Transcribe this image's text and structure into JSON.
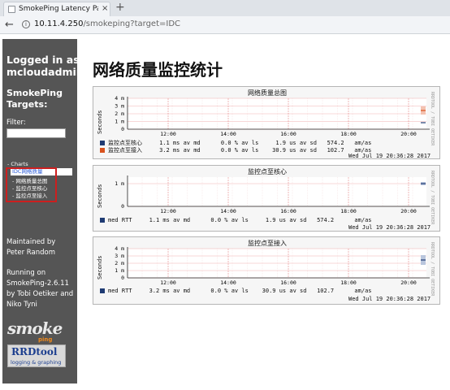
{
  "browser": {
    "tab_title": "SmokePing Latency Page for IDC",
    "tab_close": "×",
    "new_tab": "+",
    "back": "←",
    "forward": "→",
    "info": "i",
    "url_host": "10.11.4.250",
    "url_path": "/smokeping?target=IDC"
  },
  "sidebar": {
    "logged_in_line1": "Logged in as",
    "logged_in_line2": "mcloudadmin",
    "targets_line1": "SmokePing",
    "targets_line2": "Targets:",
    "filter_label": "Filter:",
    "charts_label": "- Charts",
    "current_target": "IDC网络质量",
    "items": [
      "- 网络质量总图",
      "- 监控点至核心",
      "- 监控点至接入"
    ],
    "maint_line1": "Maintained by",
    "maint_line2": "Peter Random",
    "running_lines": [
      "Running on",
      "SmokePing-2.6.11",
      "by Tobi Oetiker and",
      "Niko Tyni"
    ],
    "logo_smoke": "smoke",
    "logo_ping": "ping",
    "logo_rrd_title": "RRDtool",
    "logo_rrd_sub": "logging & graphing"
  },
  "main": {
    "title": "网络质量监控统计"
  },
  "graphs": [
    {
      "title": "网络质量总图",
      "ylabel": "Seconds",
      "side_text": "RRDTOOL / TOBI OETIKER",
      "yticks": [
        "4 m",
        "3 m",
        "2 m",
        "1 m",
        "0"
      ],
      "xticks": [
        "12:00",
        "14:00",
        "16:00",
        "18:00",
        "20:00"
      ],
      "legend": [
        {
          "color": "#1f3b73",
          "text": "监控点至核心     1.1 ms av md      0.0 % av ls     1.9 us av sd   574.2   am/as"
        },
        {
          "color": "#d9531e",
          "text": "监控点至接入     3.2 ms av md      0.0 % av ls    30.9 us av sd   102.7   am/as"
        }
      ],
      "date": "Wed Jul 19 20:36:28 2017"
    },
    {
      "title": "监控点至核心",
      "ylabel": "Seconds",
      "side_text": "RRDTOOL / TOBI OETIKER",
      "yticks": [
        "1 m",
        "0"
      ],
      "xticks": [
        "12:00",
        "14:00",
        "16:00",
        "18:00",
        "20:00"
      ],
      "legend": [
        {
          "color": "#1f3b73",
          "text": "med RTT     1.1 ms av md      0.0 % av ls     1.9 us av sd   574.2      am/as"
        }
      ],
      "date": "Wed Jul 19 20:36:28 2017"
    },
    {
      "title": "监控点至接入",
      "ylabel": "Seconds",
      "side_text": "RRDTOOL / TOBI OETIKER",
      "yticks": [
        "4 m",
        "3 m",
        "2 m",
        "1 m",
        "0"
      ],
      "xticks": [
        "12:00",
        "14:00",
        "16:00",
        "18:00",
        "20:00"
      ],
      "legend": [
        {
          "color": "#1f3b73",
          "text": "med RTT     3.2 ms av md      0.0 % av ls    30.9 us av sd   102.7      am/as"
        }
      ],
      "date": "Wed Jul 19 20:36:28 2017"
    }
  ],
  "colors": {
    "sidebar_bg": "#555555",
    "highlight_box": "#cc1f1f",
    "series_core": "#1f3b73",
    "series_access": "#d9531e"
  }
}
